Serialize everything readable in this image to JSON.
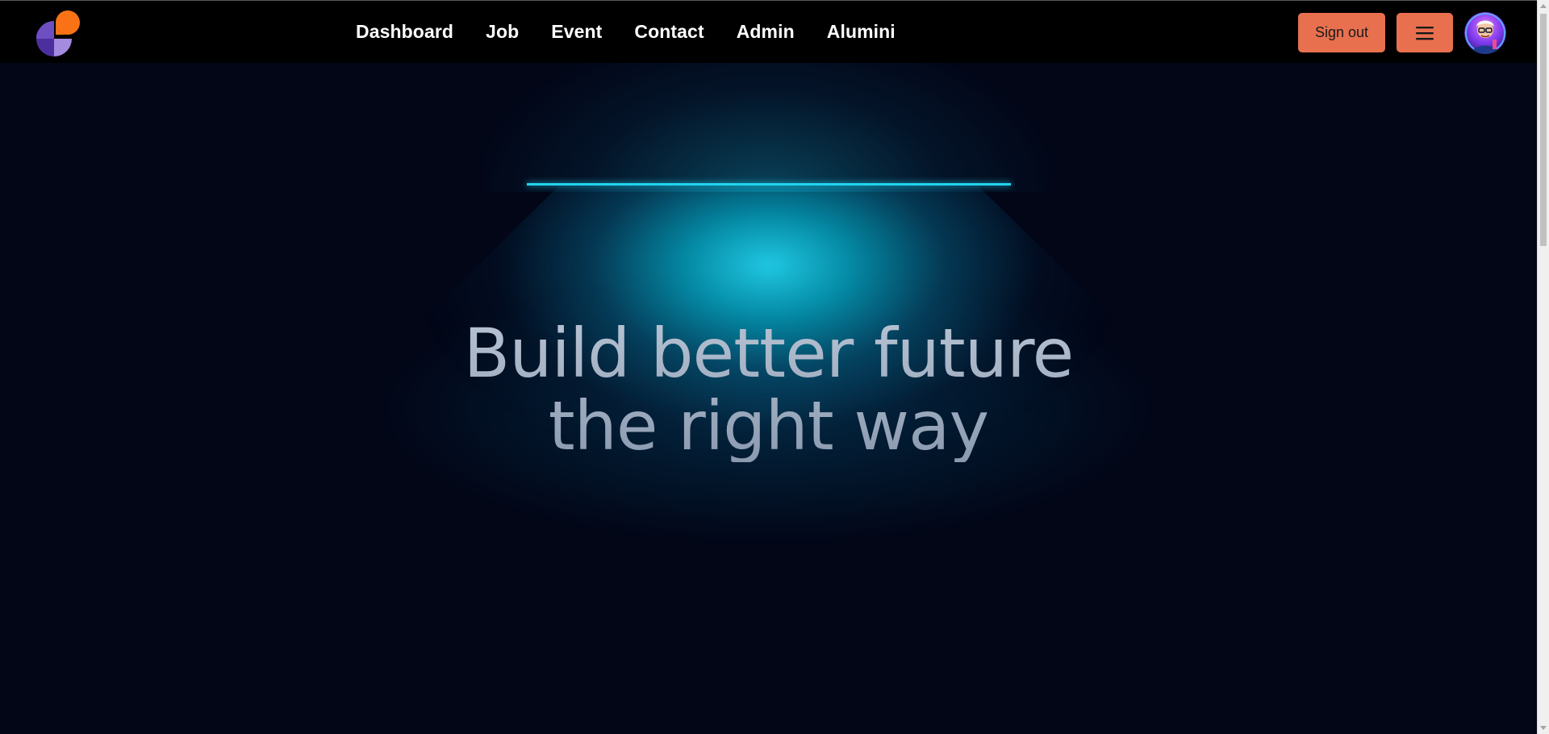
{
  "navbar": {
    "links": [
      {
        "label": "Dashboard"
      },
      {
        "label": "Job"
      },
      {
        "label": "Event"
      },
      {
        "label": "Contact"
      },
      {
        "label": "Admin"
      },
      {
        "label": "Alumini"
      }
    ],
    "signout_label": "Sign out",
    "menu_icon": "hamburger-icon",
    "avatar_icon": "user-avatar"
  },
  "hero": {
    "headline_line1": "Build better future",
    "headline_line2": "the right way"
  },
  "colors": {
    "navbar_bg": "#000000",
    "page_bg": "#020617",
    "accent_button": "#e8704f",
    "lamp_glow": "#22d3ee",
    "logo_orange": "#f97316",
    "logo_purple": "#6d4fc2"
  }
}
